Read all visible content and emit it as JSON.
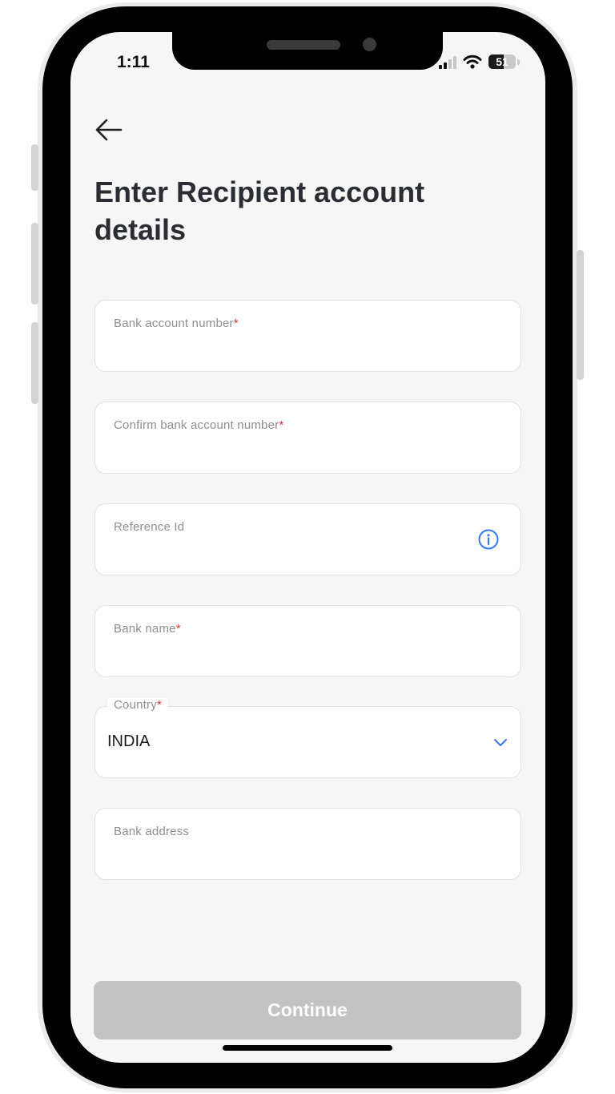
{
  "status_bar": {
    "time": "1:11",
    "battery": "51"
  },
  "header": {
    "title": "Enter Recipient account details"
  },
  "form": {
    "fields": [
      {
        "label": "Bank account number",
        "required_mark": "*",
        "value": ""
      },
      {
        "label": "Confirm bank account number",
        "required_mark": "*",
        "value": ""
      },
      {
        "label": "Reference Id",
        "required_mark": "",
        "value": "",
        "icon": "info-icon"
      },
      {
        "label": "Bank name",
        "required_mark": "*",
        "value": ""
      },
      {
        "label": "Country",
        "required_mark": "*",
        "value": "INDIA",
        "icon": "chevron-down-icon"
      },
      {
        "label": "Bank address",
        "required_mark": "",
        "value": ""
      }
    ]
  },
  "actions": {
    "continue_label": "Continue"
  },
  "colors": {
    "accent": "#3478f6",
    "required": "#e0322f",
    "disabled_button": "#c3c3c3",
    "screen_background": "#f6f6f6"
  }
}
